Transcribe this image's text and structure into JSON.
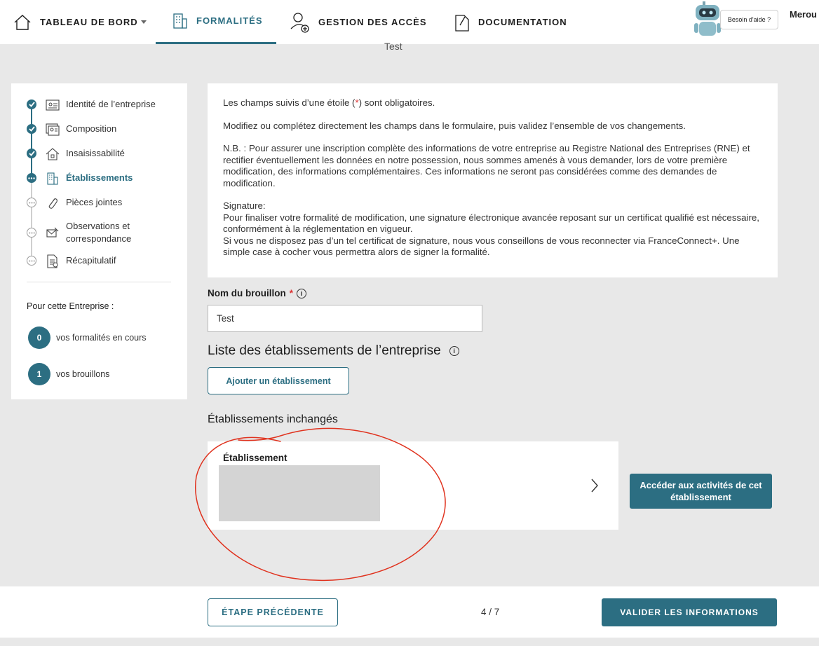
{
  "nav": {
    "dashboard": "TABLEAU DE BORD",
    "formalities": "FORMALITÉS",
    "access": "GESTION DES ACCÈS",
    "documentation": "DOCUMENTATION",
    "help": "Besoin d'aide ?",
    "user": "Merou"
  },
  "behind_title": "Test",
  "steps": [
    {
      "label": "Identité de l’entreprise",
      "state": "done",
      "icon": "id-card-icon"
    },
    {
      "label": "Composition",
      "state": "done",
      "icon": "people-card-icon"
    },
    {
      "label": "Insaisissabilité",
      "state": "done",
      "icon": "house-icon"
    },
    {
      "label": "Établissements",
      "state": "current",
      "icon": "building-icon"
    },
    {
      "label": "Pièces jointes",
      "state": "todo",
      "icon": "paperclip-icon"
    },
    {
      "label": "Observations et correspondance",
      "state": "todo",
      "icon": "envelope-icon"
    },
    {
      "label": "Récapitulatif",
      "state": "todo",
      "icon": "document-icon"
    }
  ],
  "sidebar": {
    "section_title": "Pour cette Entreprise :",
    "in_progress_count": "0",
    "in_progress_label": "vos formalités en cours",
    "drafts_count": "1",
    "drafts_label": "vos brouillons"
  },
  "info": {
    "required_pre": "Les champs suivis d’une étoile (",
    "required_star": "*",
    "required_post": ") sont obligatoires.",
    "modify": "Modifiez ou complétez directement les champs dans le formulaire, puis validez l’ensemble de vos changements.",
    "nb": "N.B. : Pour assurer une inscription complète des informations de votre entreprise au Registre National des Entreprises (RNE) et rectifier éventuellement les données en notre possession, nous sommes amenés à vous demander, lors de votre première modification, des informations complémentaires. Ces informations ne seront pas considérées comme des demandes de modification.",
    "signature_title": "Signature:",
    "signature_1": "Pour finaliser votre formalité de modification, une signature électronique avancée reposant sur un certificat qualifié est nécessaire, conformément à la réglementation en vigueur.",
    "signature_2": "Si vous ne disposez pas d’un tel certificat de signature, nous vous conseillons de vous reconnecter via FranceConnect+. Une simple case à cocher vous permettra alors de signer la formalité."
  },
  "form": {
    "draft_label": "Nom du brouillon",
    "required_star": "*",
    "draft_value": "Test",
    "list_title": "Liste des établissements de l’entreprise",
    "add_button": "Ajouter un établissement",
    "unchanged_title": "Établissements inchangés",
    "establishment_label": "Établissement",
    "activities_button": "Accéder aux activités de cet établissement"
  },
  "footer": {
    "prev": "ÉTAPE PRÉCÉDENTE",
    "page": "4 / 7",
    "validate": "VALIDER LES INFORMATIONS"
  },
  "colors": {
    "accent": "#2c6e82",
    "required": "#dd3333",
    "annotation": "#e0321e"
  }
}
